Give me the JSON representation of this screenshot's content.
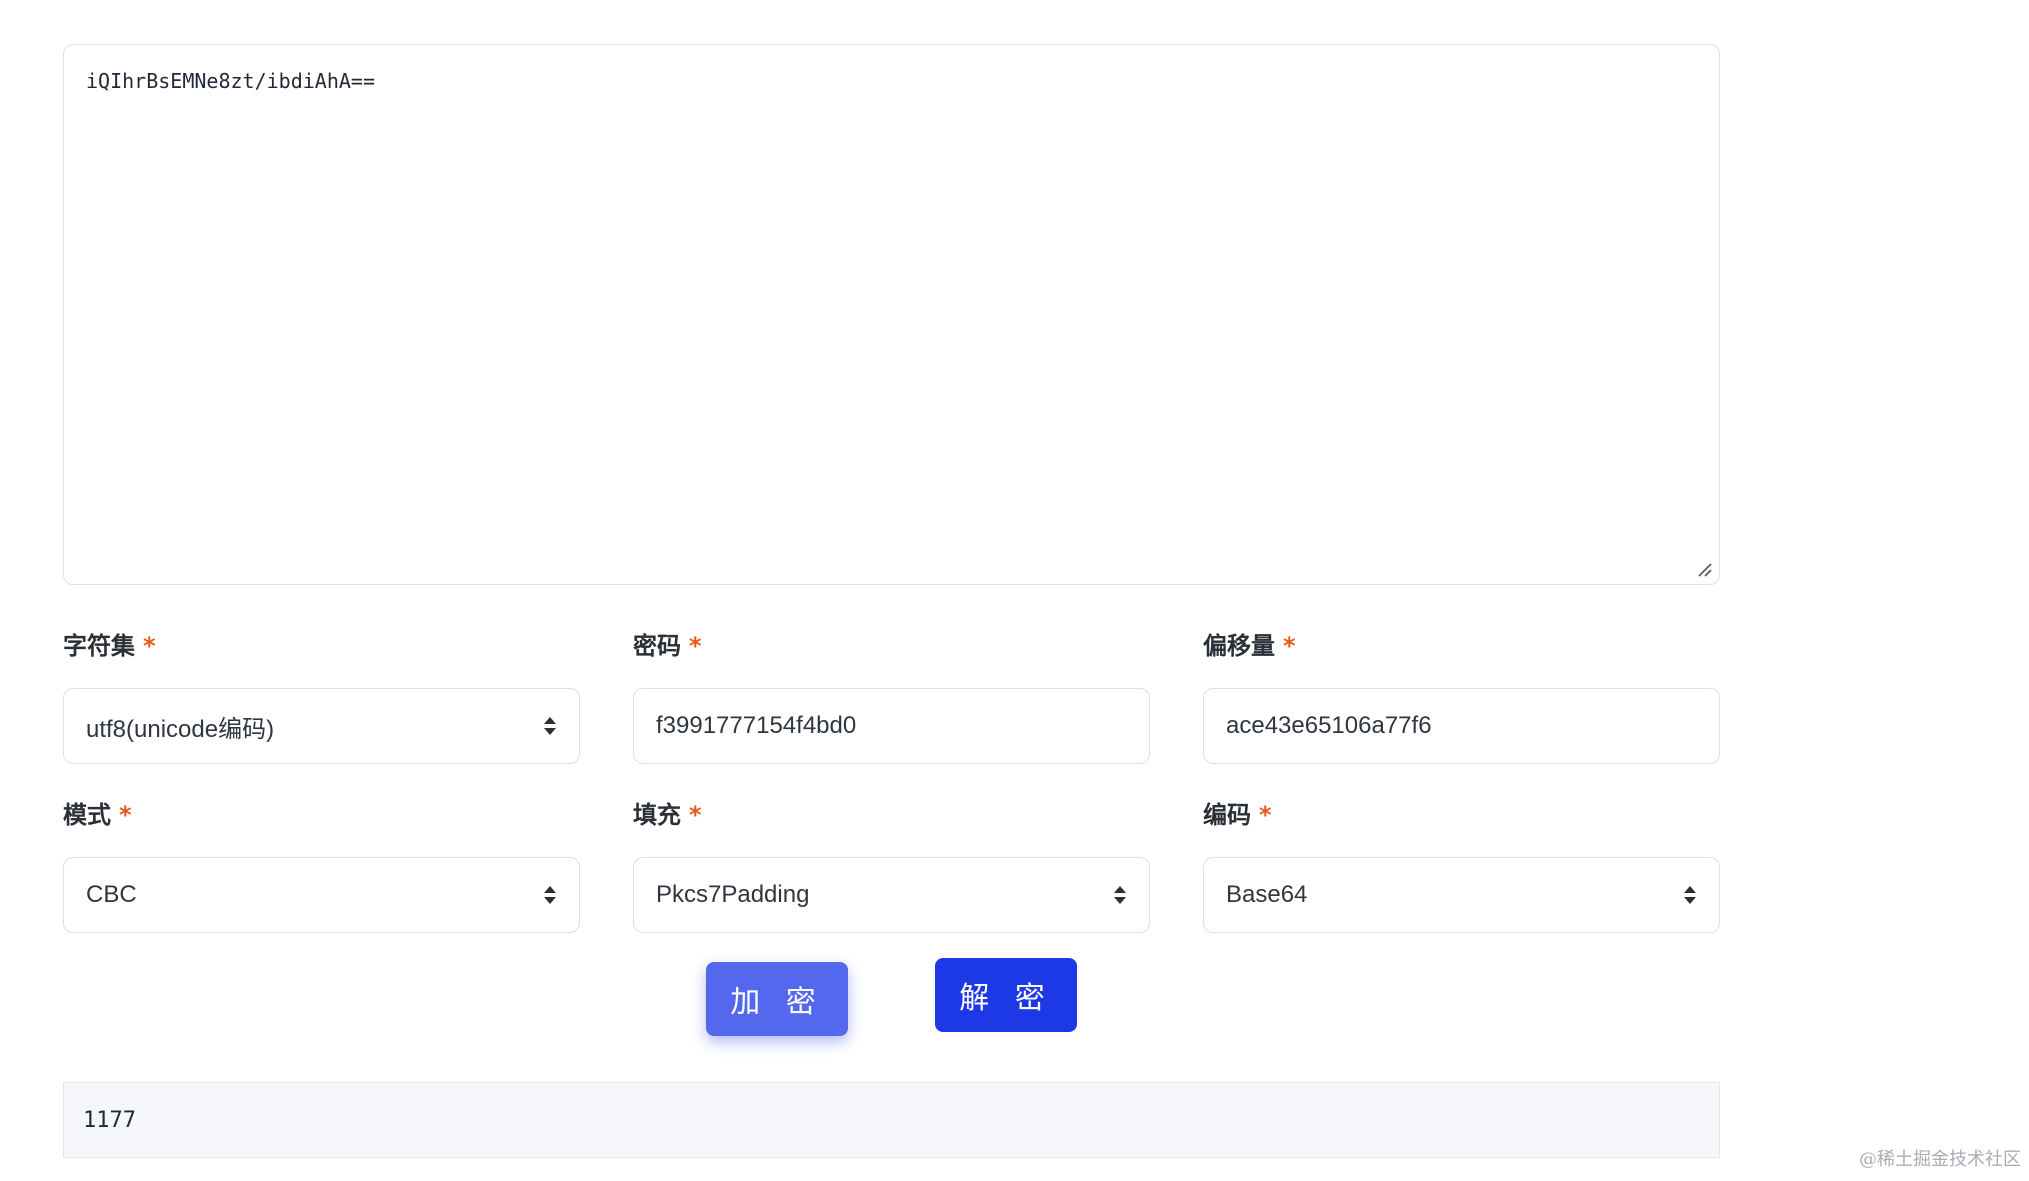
{
  "input": {
    "text": "iQIhrBsEMNe8zt/ibdiAhA=="
  },
  "fields": {
    "charset": {
      "label": "字符集",
      "value": "utf8(unicode编码)"
    },
    "password": {
      "label": "密码",
      "value": "f3991777154f4bd0"
    },
    "offset": {
      "label": "偏移量",
      "value": "ace43e65106a77f6"
    },
    "mode": {
      "label": "模式",
      "value": "CBC"
    },
    "padding": {
      "label": "填充",
      "value": "Pkcs7Padding"
    },
    "encoding": {
      "label": "编码",
      "value": "Base64"
    }
  },
  "required_mark": "*",
  "buttons": {
    "encrypt_label": "加 密",
    "decrypt_label": "解 密"
  },
  "result": {
    "text": "1177"
  },
  "watermark": "@稀土掘金技术社区",
  "colors": {
    "required": "#e8591c",
    "encrypt_button": "#5468ee",
    "decrypt_button": "#1d39e6"
  },
  "icons": {
    "select_arrows": "sort-arrows-icon",
    "resize_handle": "resize-handle-icon"
  }
}
